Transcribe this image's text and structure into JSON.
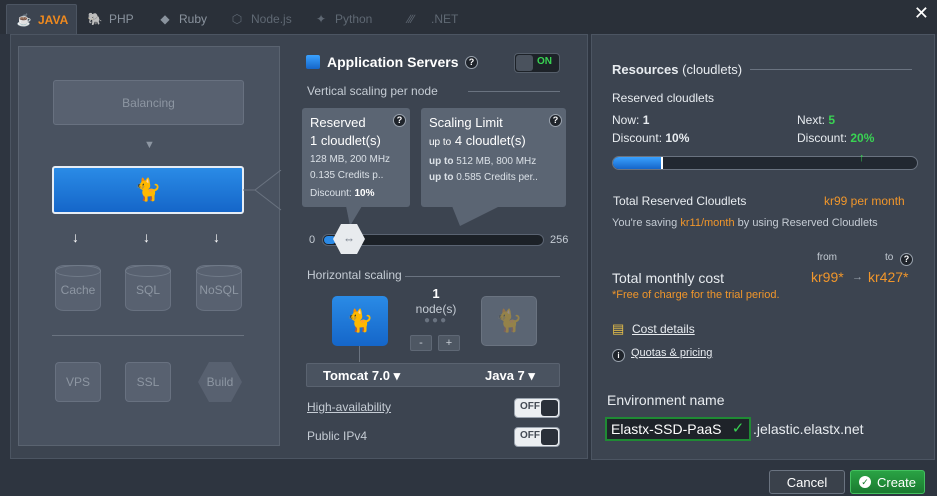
{
  "tabs": [
    {
      "label": "JAVA",
      "icon": "java-icon",
      "state": "active"
    },
    {
      "label": "PHP",
      "icon": "php-icon",
      "state": "normal"
    },
    {
      "label": "Ruby",
      "icon": "ruby-icon",
      "state": "normal"
    },
    {
      "label": "Node.js",
      "icon": "nodejs-icon",
      "state": "disabled"
    },
    {
      "label": "Python",
      "icon": "python-icon",
      "state": "disabled"
    },
    {
      "label": ".NET",
      "icon": "dotnet-icon",
      "state": "disabled"
    }
  ],
  "close_icon": "close-icon",
  "topology": {
    "balancing": "Balancing",
    "app_server_icon": "tomcat-icon",
    "cache": "Cache",
    "sql": "SQL",
    "nosql": "NoSQL",
    "vps": "VPS",
    "ssl": "SSL",
    "build": "Build"
  },
  "app_servers": {
    "title": "Application Servers",
    "toggle": "ON",
    "vertical_label": "Vertical scaling per node",
    "reserved": {
      "title": "Reserved",
      "value": "1 cloudlet(s)",
      "spec": "128 MB, 200 MHz",
      "credits": "0.135 Credits p..",
      "discount_label": "Discount:",
      "discount": "10%"
    },
    "limit": {
      "title": "Scaling Limit",
      "prefix": "up to",
      "value": "4 cloudlet(s)",
      "spec_prefix": "up to",
      "spec": "512 MB, 800 MHz",
      "credits_prefix": "up to",
      "credits": "0.585 Credits per.."
    },
    "slider": {
      "min": "0",
      "max": "256",
      "reserved": 1,
      "limit": 4
    },
    "horizontal_label": "Horizontal scaling",
    "nodes_count": "1",
    "nodes_label": "node(s)",
    "minus": "-",
    "plus": "+",
    "server_select": "Tomcat 7.0",
    "java_select": "Java 7",
    "ha_label": "High-availability",
    "ha_toggle": "OFF",
    "ipv4_label": "Public IPv4",
    "ipv4_toggle": "OFF"
  },
  "resources": {
    "title": "Resources",
    "title_unit": "(cloudlets)",
    "reserved_heading": "Reserved cloudlets",
    "now_label": "Now:",
    "now_value": "1",
    "next_label": "Next:",
    "next_value": "5",
    "discount_label": "Discount:",
    "discount_now": "10%",
    "discount_next": "20%",
    "total_reserved_label": "Total Reserved Cloudlets",
    "total_reserved_value": "kr99 per month",
    "saving_prefix": "You're saving",
    "saving_value": "kr11/month",
    "saving_suffix": "by using Reserved Cloudlets",
    "from_label": "from",
    "to_label": "to",
    "total_monthly_label": "Total monthly cost",
    "cost_from": "kr99*",
    "cost_arrow": "→",
    "cost_to": "kr427*",
    "trial_note": "*Free of charge for the trial period.",
    "cost_details": "Cost details",
    "quotas": "Quotas & pricing",
    "bar_fill": 0.16
  },
  "environment": {
    "label": "Environment name",
    "value": "Elastx-SSD-PaaS",
    "domain": ".jelastic.elastx.net"
  },
  "buttons": {
    "cancel": "Cancel",
    "create": "Create"
  },
  "colors": {
    "accent_orange": "#f0962b",
    "accent_green": "#39d353",
    "primary_blue": "#1e78dd",
    "background": "#2e3540"
  }
}
